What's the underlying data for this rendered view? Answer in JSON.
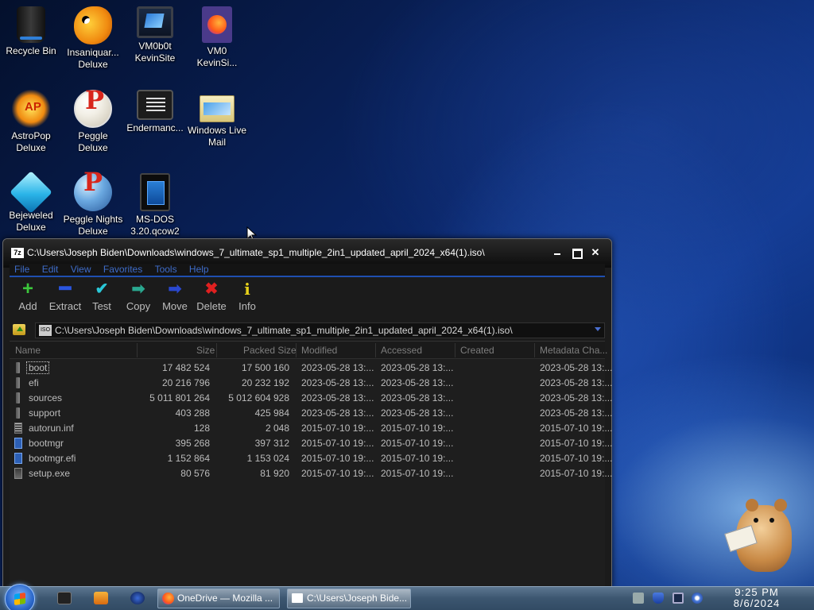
{
  "desktop": {
    "icons": [
      {
        "label_line1": "Recycle Bin",
        "label_line2": ""
      },
      {
        "label_line1": "Insaniquar...",
        "label_line2": "Deluxe"
      },
      {
        "label_line1": "VM0b0t",
        "label_line2": "KevinSite"
      },
      {
        "label_line1": "VM0",
        "label_line2": "KevinSi..."
      },
      {
        "label_line1": "AstroPop",
        "label_line2": "Deluxe"
      },
      {
        "label_line1": "Peggle Deluxe",
        "label_line2": ""
      },
      {
        "label_line1": "Endermanc...",
        "label_line2": ""
      },
      {
        "label_line1": "Windows Live",
        "label_line2": "Mail"
      },
      {
        "label_line1": "Bejeweled",
        "label_line2": "Deluxe"
      },
      {
        "label_line1": "Peggle Nights",
        "label_line2": "Deluxe"
      },
      {
        "label_line1": "MS-DOS",
        "label_line2": "3.20.qcow2"
      }
    ]
  },
  "window": {
    "app_icon_text": "7z",
    "title": "C:\\Users\\Joseph Biden\\Downloads\\windows_7_ultimate_sp1_multiple_2in1_updated_april_2024_x64(1).iso\\",
    "menu": [
      "File",
      "Edit",
      "View",
      "Favorites",
      "Tools",
      "Help"
    ],
    "toolbar": [
      {
        "label": "Add",
        "icon": "plus-icon",
        "color": "#3cc83c"
      },
      {
        "label": "Extract",
        "icon": "minus-icon",
        "color": "#2a55e0"
      },
      {
        "label": "Test",
        "icon": "checkmark-icon",
        "color": "#2ac8d8"
      },
      {
        "label": "Copy",
        "icon": "copy-arrow-icon",
        "color": "#2aa890"
      },
      {
        "label": "Move",
        "icon": "move-arrow-icon",
        "color": "#2a48d0"
      },
      {
        "label": "Delete",
        "icon": "x-icon",
        "color": "#e02020"
      },
      {
        "label": "Info",
        "icon": "info-icon",
        "color": "#e8d21a"
      }
    ],
    "address": {
      "icon_text": "ISO",
      "path": "C:\\Users\\Joseph Biden\\Downloads\\windows_7_ultimate_sp1_multiple_2in1_updated_april_2024_x64(1).iso\\"
    },
    "columns": [
      "Name",
      "Size",
      "Packed Size",
      "Modified",
      "Accessed",
      "Created",
      "Metadata Cha..."
    ],
    "files": [
      {
        "name": "boot",
        "type": "folder",
        "size": "17 482 524",
        "packed": "17 500 160",
        "modified": "2023-05-28 13:...",
        "accessed": "2023-05-28 13:...",
        "created": "",
        "meta": "2023-05-28 13:..."
      },
      {
        "name": "efi",
        "type": "folder",
        "size": "20 216 796",
        "packed": "20 232 192",
        "modified": "2023-05-28 13:...",
        "accessed": "2023-05-28 13:...",
        "created": "",
        "meta": "2023-05-28 13:..."
      },
      {
        "name": "sources",
        "type": "folder",
        "size": "5 011 801 264",
        "packed": "5 012 604 928",
        "modified": "2023-05-28 13:...",
        "accessed": "2023-05-28 13:...",
        "created": "",
        "meta": "2023-05-28 13:..."
      },
      {
        "name": "support",
        "type": "folder",
        "size": "403 288",
        "packed": "425 984",
        "modified": "2023-05-28 13:...",
        "accessed": "2023-05-28 13:...",
        "created": "",
        "meta": "2023-05-28 13:..."
      },
      {
        "name": "autorun.inf",
        "type": "inf",
        "size": "128",
        "packed": "2 048",
        "modified": "2015-07-10 19:...",
        "accessed": "2015-07-10 19:...",
        "created": "",
        "meta": "2015-07-10 19:..."
      },
      {
        "name": "bootmgr",
        "type": "file",
        "size": "395 268",
        "packed": "397 312",
        "modified": "2015-07-10 19:...",
        "accessed": "2015-07-10 19:...",
        "created": "",
        "meta": "2015-07-10 19:..."
      },
      {
        "name": "bootmgr.efi",
        "type": "file",
        "size": "1 152 864",
        "packed": "1 153 024",
        "modified": "2015-07-10 19:...",
        "accessed": "2015-07-10 19:...",
        "created": "",
        "meta": "2015-07-10 19:..."
      },
      {
        "name": "setup.exe",
        "type": "exe",
        "size": "80 576",
        "packed": "81 920",
        "modified": "2015-07-10 19:...",
        "accessed": "2015-07-10 19:...",
        "created": "",
        "meta": "2015-07-10 19:..."
      }
    ]
  },
  "taskbar": {
    "tasks": [
      {
        "label": "OneDrive — Mozilla ...",
        "icon": "firefox-icon"
      },
      {
        "label": "C:\\Users\\Joseph Bide...",
        "icon": "7zip-icon"
      }
    ],
    "clock_time": "9:25 PM",
    "clock_date": "8/6/2024"
  },
  "colors": {
    "menu_text": "#3e6cc9",
    "window_bg": "#1b1b1b",
    "taskbar": "#3c5670"
  }
}
